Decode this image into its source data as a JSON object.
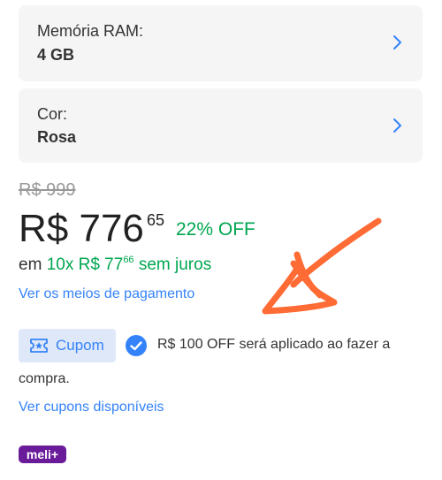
{
  "ram": {
    "label": "Memória RAM:",
    "value": "4 GB"
  },
  "color": {
    "label": "Cor:",
    "value": "Rosa"
  },
  "pricing": {
    "old_price": "R$ 999",
    "price": "R$ 776",
    "cents": "65",
    "discount": "22% OFF",
    "installments_prefix": "em",
    "installments_count": "10x R$ 77",
    "installments_cents": "66",
    "installments_suffix": "sem juros",
    "payment_link": "Ver os meios de pagamento"
  },
  "coupon": {
    "badge": "Cupom",
    "message_line1": "R$ 100 OFF será aplicado ao fazer a",
    "message_line2": "compra.",
    "link": "Ver cupons disponíveis"
  },
  "meli_badge": "meli+",
  "colors": {
    "accent_blue": "#3483fa",
    "green": "#00a650",
    "card_bg": "#f5f5f5",
    "annotation_orange": "#ff6b35",
    "meli_purple": "#6a1b9a"
  }
}
